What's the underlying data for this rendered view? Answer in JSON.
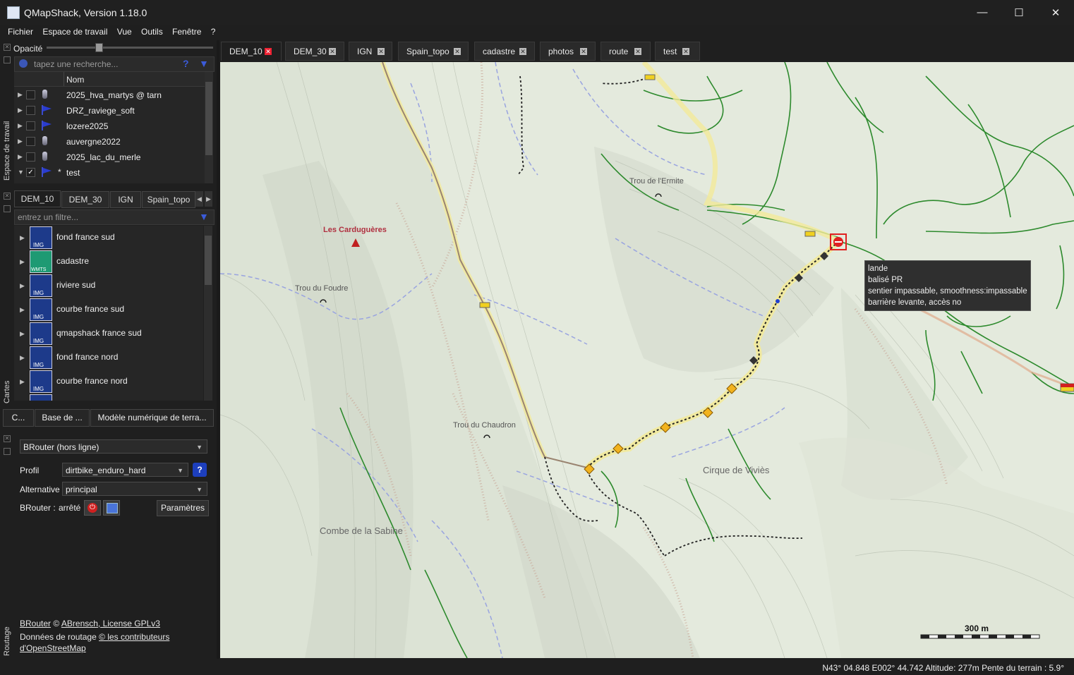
{
  "window": {
    "title": "QMapShack, Version 1.18.0"
  },
  "menu": [
    "Fichier",
    "Espace de travail",
    "Vue",
    "Outils",
    "Fenêtre",
    "?"
  ],
  "left": {
    "opacity_label": "Opacité",
    "workspace_label": "Espace de travail",
    "search_placeholder": "tapez une recherche...",
    "column_name": "Nom",
    "projects": [
      {
        "label": "2025_hva_martys @ tarn",
        "checked": false,
        "icon": "database-icon"
      },
      {
        "label": "DRZ_raviege_soft",
        "checked": false,
        "icon": "gps-flag-icon"
      },
      {
        "label": "lozere2025",
        "checked": false,
        "icon": "gps-flag-icon"
      },
      {
        "label": "auvergne2022",
        "checked": false,
        "icon": "database-icon"
      },
      {
        "label": "2025_lac_du_merle",
        "checked": false,
        "icon": "database-icon"
      },
      {
        "label": "test",
        "checked": true,
        "icon": "gps-flag-icon",
        "prefix": "*"
      }
    ],
    "cartes_label": "Cartes",
    "map_view_tabs": [
      "DEM_10",
      "DEM_30",
      "IGN",
      "Spain_topo"
    ],
    "filter_placeholder": "entrez un filtre...",
    "maps": [
      {
        "label": "fond france sud",
        "type": "IMG"
      },
      {
        "label": "cadastre",
        "type": "WMTS"
      },
      {
        "label": "riviere sud",
        "type": "IMG"
      },
      {
        "label": "courbe france sud",
        "type": "IMG"
      },
      {
        "label": "qmapshack france sud",
        "type": "IMG"
      },
      {
        "label": "fond france nord",
        "type": "IMG"
      },
      {
        "label": "courbe france nord",
        "type": "IMG"
      }
    ],
    "dock_tabs": [
      "C...",
      "Base de ...",
      "Modèle numérique de terra..."
    ],
    "routing": {
      "label": "Routage",
      "router": "BRouter (hors ligne)",
      "profile_label": "Profil",
      "profile": "dirtbike_enduro_hard",
      "alternative_label": "Alternative",
      "alternative": "principal",
      "status_label": "BRouter :",
      "status": "arrêté",
      "params_button": "Paramètres",
      "credit_brouter": "BRouter",
      "credit_copy": "©",
      "credit_author": "ABrensch, License GPLv3",
      "credit_data": "Données de routage",
      "credit_osm1": "© les contributeurs",
      "credit_osm2": "d'OpenStreetMap"
    }
  },
  "map_tabs": [
    "DEM_10",
    "DEM_30",
    "IGN",
    "Spain_topo",
    "cadastre",
    "photos",
    "route",
    "test"
  ],
  "map": {
    "labels": {
      "trou_ermite": "Trou de l'Ermite",
      "cardugueres": "Les Carduguères",
      "trou_foudre": "Trou du Foudre",
      "trou_chaudron": "Trou du Chaudron",
      "cirque": "Cirque de Viviès",
      "combe": "Combe de la Sabine"
    },
    "tooltip": [
      "lande",
      "balisé PR",
      "sentier impassable, smoothness:impassable",
      "barrière levante, accès no"
    ],
    "scale": "300 m"
  },
  "status": {
    "coords": "N43° 04.848 E002° 44.742",
    "altitude": "Altitude: 277m",
    "slope": "Pente du terrain : 5.9°"
  },
  "colors": {
    "accent_active_close": "#e02a34",
    "map_background": "#e4eadd",
    "route_highlight": "#f2e88a",
    "waypoint": "#f2b31e"
  }
}
